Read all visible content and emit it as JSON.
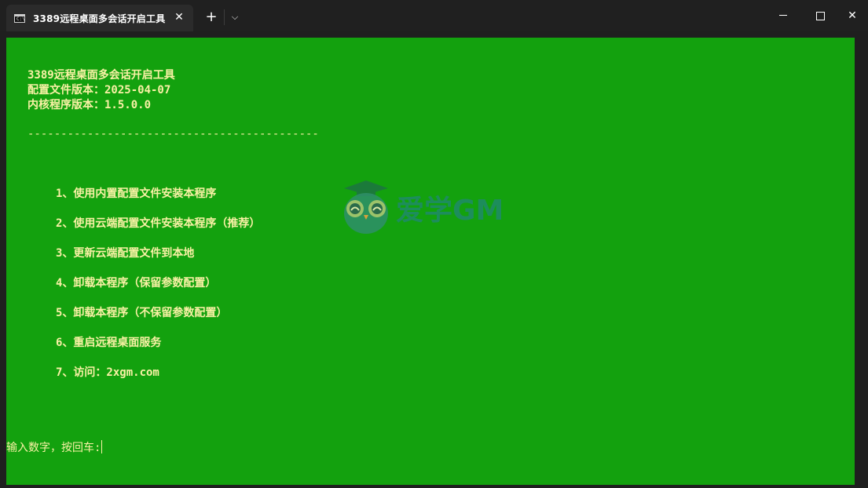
{
  "titlebar": {
    "tab_icon_text": "C:\\",
    "tab_title": "3389远程桌面多会话开启工具",
    "close_glyph": "✕",
    "new_tab_glyph": "+",
    "dropdown_glyph": "⌵",
    "window_close_glyph": "✕"
  },
  "terminal": {
    "header": [
      "3389远程桌面多会话开启工具",
      "配置文件版本：2025-04-07",
      "内核程序版本：1.5.0.0"
    ],
    "divider": "--------------------------------------------",
    "menu": [
      "1、使用内置配置文件安装本程序",
      "2、使用云端配置文件安装本程序（推荐）",
      "3、更新云端配置文件到本地",
      "4、卸载本程序（保留参数配置）",
      "5、卸载本程序（不保留参数配置）",
      "6、重启远程桌面服务",
      "7、访问：2xgm.com"
    ],
    "prompt": "输入数字，按回车:"
  },
  "watermark": {
    "text": "爱学GM"
  },
  "colors": {
    "terminal_bg": "#13a10e",
    "terminal_fg": "#f9f1a5",
    "titlebar_bg": "#202020",
    "tab_bg": "#2b2b2b"
  }
}
